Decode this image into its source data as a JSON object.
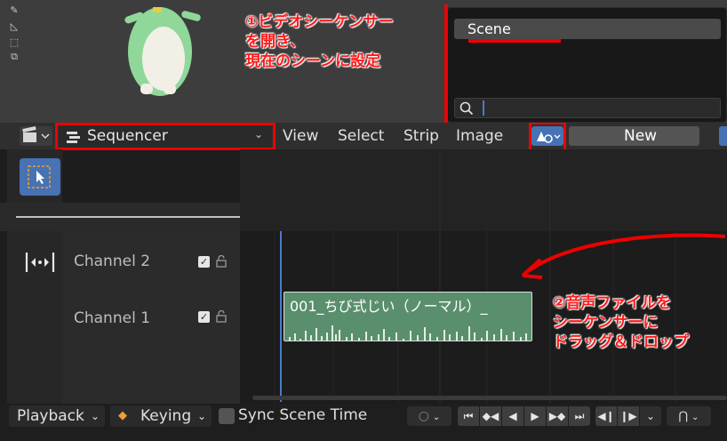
{
  "scene_popup": {
    "item": "Scene",
    "search_placeholder": ""
  },
  "header": {
    "editor_type_icon": "clapperboard-icon",
    "view_type": "Sequencer",
    "menus": [
      "View",
      "Select",
      "Strip",
      "Image"
    ],
    "new_label": "New"
  },
  "channels": {
    "items": [
      {
        "label": "Channel 2"
      },
      {
        "label": "Channel 1"
      }
    ]
  },
  "strip": {
    "name": "001_ちび式じい（ノーマル）_",
    "color": "#5a8f6e"
  },
  "bottom_bar": {
    "playback": "Playback",
    "keying": "Keying",
    "sync": "Sync Scene Time"
  },
  "annotations": {
    "note1_line1": "①ビデオシーケンサー",
    "note1_line2": "を開き、",
    "note1_line3": "現在のシーンに設定",
    "note2_line1": "②音声ファイルを",
    "note2_line2": "シーケンサーに",
    "note2_line3": "ドラッグ＆ドロップ",
    "color": "#ff1a1a"
  },
  "colors": {
    "accent": "#4772b3",
    "playhead": "#4a7bd0"
  }
}
